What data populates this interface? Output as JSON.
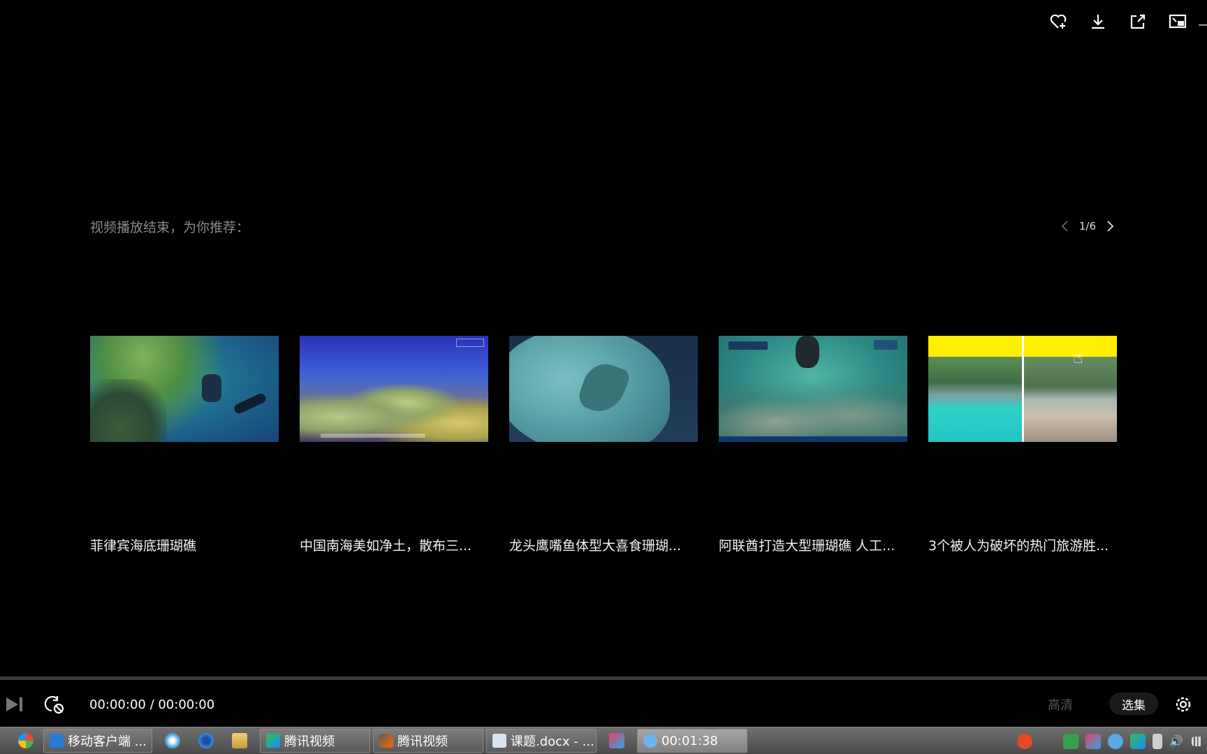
{
  "toolbar": {
    "icons": [
      "heart-plus-icon",
      "download-icon",
      "share-out-icon",
      "picture-in-picture-icon",
      "minimize-icon"
    ]
  },
  "recommend": {
    "title": "视频播放结束，为你推荐：",
    "pager": {
      "current": "1",
      "separator": "/",
      "total": "6"
    },
    "items": [
      {
        "title": "菲律宾海底珊瑚礁"
      },
      {
        "title": "中国南海美如净土，散布三..."
      },
      {
        "title": "龙头鹰嘴鱼体型大喜食珊瑚..."
      },
      {
        "title": "阿联酋打造大型珊瑚礁 人工..."
      },
      {
        "title": "3个被人为破坏的热门旅游胜..."
      }
    ]
  },
  "player": {
    "time": "00:00:00 / 00:00:00",
    "quality": "高清",
    "episodes": "选集"
  },
  "taskbar": {
    "tasks": [
      {
        "label": "移动客户端 ...",
        "icon": "ie-icon"
      },
      {
        "label": "腾讯视频",
        "icon": "tencent-video-icon"
      },
      {
        "label": "腾讯视频",
        "icon": "tencent-video-icon"
      },
      {
        "label": "课题.docx - ...",
        "icon": "word-icon"
      },
      {
        "label": "00:01:38",
        "icon": "recorder-icon"
      }
    ]
  },
  "colors": {
    "background": "#000000",
    "muted_text": "#8a8a8a",
    "taskbar": "#5a5a5a"
  }
}
